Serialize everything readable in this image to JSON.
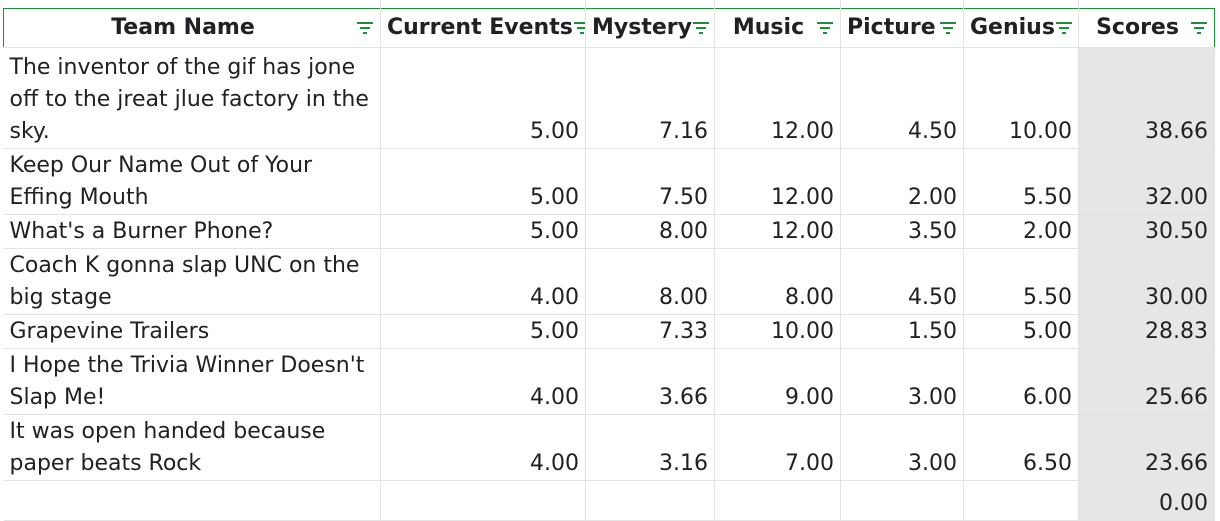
{
  "columns": [
    {
      "label": "Team Name"
    },
    {
      "label": "Current Events"
    },
    {
      "label": "Mystery"
    },
    {
      "label": "Music"
    },
    {
      "label": "Picture"
    },
    {
      "label": "Genius"
    },
    {
      "label": "Scores"
    }
  ],
  "rows": [
    {
      "team": "The inventor of the gif has jone off to the jreat jlue factory in the sky.",
      "current_events": "5.00",
      "mystery": "7.16",
      "music": "12.00",
      "picture": "4.50",
      "genius": "10.00",
      "scores": "38.66"
    },
    {
      "team": "Keep Our Name Out of Your Effing Mouth",
      "current_events": "5.00",
      "mystery": "7.50",
      "music": "12.00",
      "picture": "2.00",
      "genius": "5.50",
      "scores": "32.00"
    },
    {
      "team": "What's a Burner Phone?",
      "current_events": "5.00",
      "mystery": "8.00",
      "music": "12.00",
      "picture": "3.50",
      "genius": "2.00",
      "scores": "30.50"
    },
    {
      "team": "Coach K gonna slap UNC on the big stage",
      "current_events": "4.00",
      "mystery": "8.00",
      "music": "8.00",
      "picture": "4.50",
      "genius": "5.50",
      "scores": "30.00"
    },
    {
      "team": "Grapevine Trailers",
      "current_events": "5.00",
      "mystery": "7.33",
      "music": "10.00",
      "picture": "1.50",
      "genius": "5.00",
      "scores": "28.83"
    },
    {
      "team": "I Hope the Trivia Winner Doesn't Slap Me!",
      "current_events": "4.00",
      "mystery": "3.66",
      "music": "9.00",
      "picture": "3.00",
      "genius": "6.00",
      "scores": "25.66"
    },
    {
      "team": "It was open handed because paper beats Rock",
      "current_events": "4.00",
      "mystery": "3.16",
      "music": "7.00",
      "picture": "3.00",
      "genius": "6.50",
      "scores": "23.66"
    },
    {
      "team": "",
      "current_events": "",
      "mystery": "",
      "music": "",
      "picture": "",
      "genius": "",
      "scores": "0.00"
    }
  ],
  "colors": {
    "header_border": "#1e8e3e",
    "filter_icon": "#1e8e3e",
    "score_fill": "#e6e6e6",
    "gridline": "#e2e3e3"
  },
  "icons": {
    "filter": "filter-icon"
  }
}
